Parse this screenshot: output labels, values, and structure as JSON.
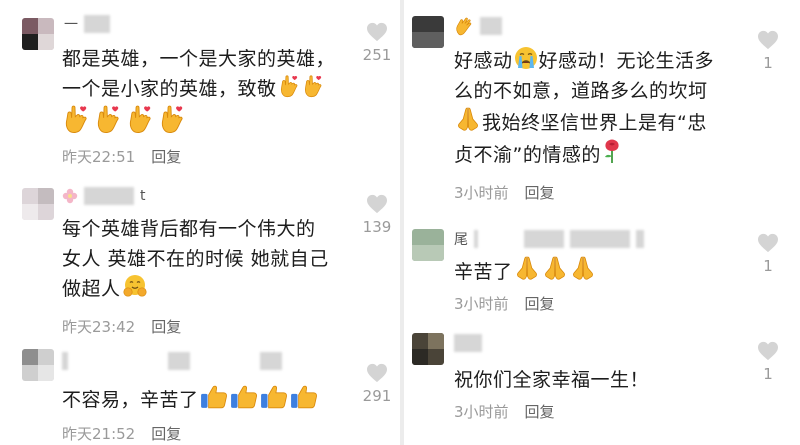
{
  "left": {
    "comments": [
      {
        "lines": [
          "都是英雄，一个是大家的英雄，",
          "一个是小家的英雄，致敬"
        ],
        "time": "昨天22:51",
        "reply": "回复",
        "likes": "251",
        "username_prefix": "一"
      },
      {
        "lines": [
          "每个英雄背后都有一个伟大的",
          "女人 英雄不在的时候 她就自己",
          "做超人"
        ],
        "time": "昨天23:42",
        "reply": "回复",
        "likes": "139",
        "username_suffix": "t"
      },
      {
        "lines": [
          "不容易，辛苦了"
        ],
        "time": "昨天21:52",
        "reply": "回复",
        "likes": "291"
      }
    ]
  },
  "right": {
    "comments": [
      {
        "lines": [
          "好感动",
          "好感动！无论生活多",
          "么的不如意，道路多么的坎坷",
          "我始终坚信世界上是有“忠",
          "贞不渝”的情感的"
        ],
        "time": "3小时前",
        "reply": "回复",
        "likes": "1"
      },
      {
        "lines": [
          "辛苦了"
        ],
        "time": "3小时前",
        "reply": "回复",
        "likes": "1",
        "username_prefix": "尾"
      },
      {
        "lines": [
          "祝你们全家幸福一生！"
        ],
        "time": "3小时前",
        "reply": "回复",
        "likes": "1"
      }
    ]
  },
  "icons": {
    "like": "heart-icon",
    "love_you": "love-you-gesture-icon",
    "thumbs_up": "thumbs-up-icon",
    "pray": "folded-hands-icon",
    "crying": "crying-face-icon",
    "hug": "hugging-face-icon",
    "rose": "rose-icon",
    "heart": "red-heart-icon",
    "clap": "clapping-hands-icon"
  },
  "colors": {
    "meta": "#9a9a9a",
    "heart": "#cfcfcf",
    "emoji": "#f7b731"
  }
}
